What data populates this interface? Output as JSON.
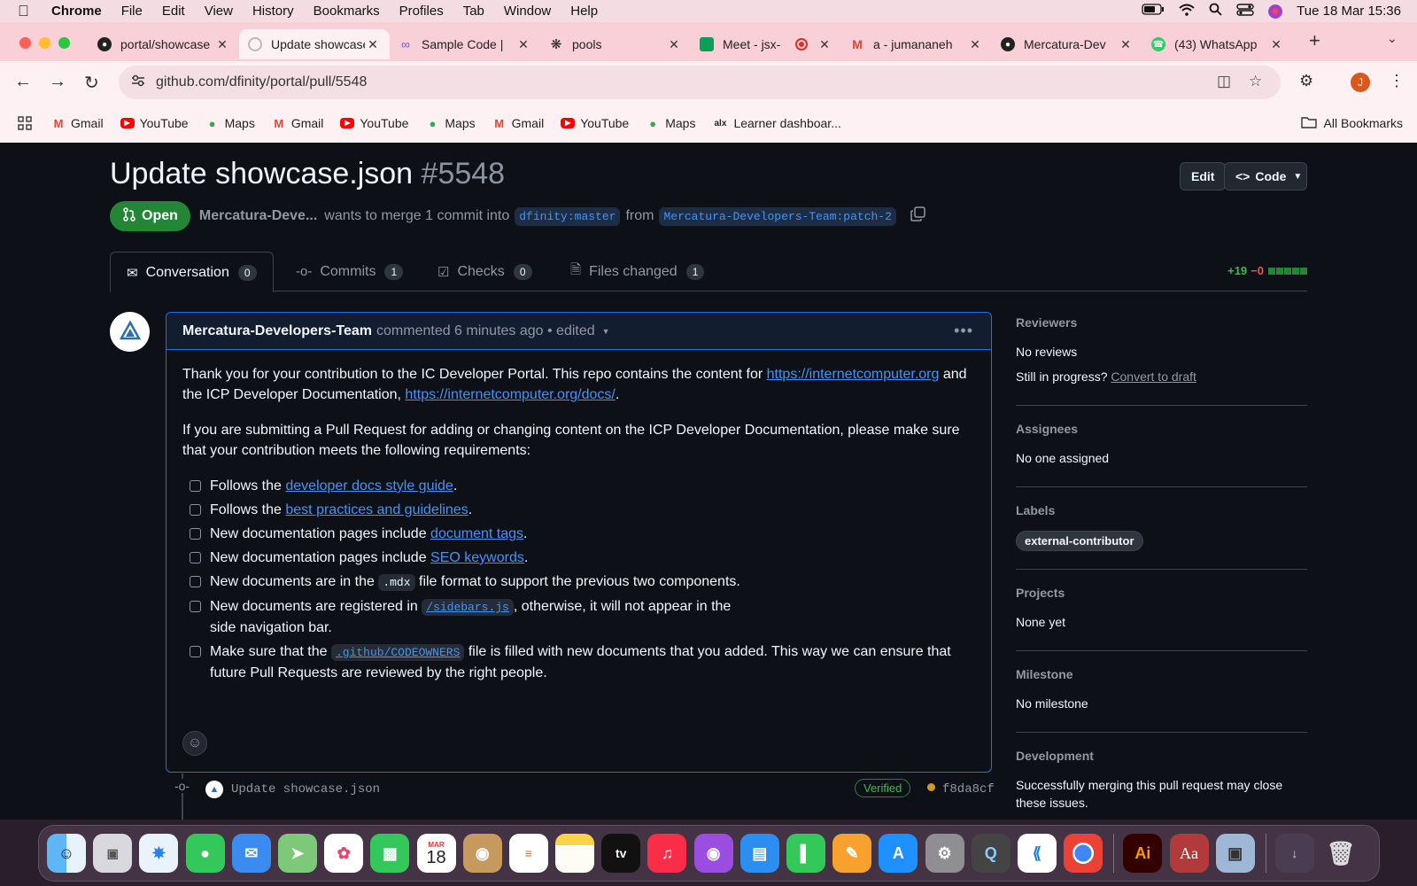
{
  "menubar": {
    "app": "Chrome",
    "items": [
      "File",
      "Edit",
      "View",
      "History",
      "Bookmarks",
      "Profiles",
      "Tab",
      "Window",
      "Help"
    ],
    "clock": "Tue 18 Mar  15:36"
  },
  "tabs": [
    {
      "title": "portal/showcase",
      "icon": "github-icon",
      "active": false
    },
    {
      "title": "Update showcase",
      "icon": "loading-icon",
      "active": true
    },
    {
      "title": "Sample Code |",
      "icon": "link-icon",
      "active": false
    },
    {
      "title": "pools",
      "icon": "openai-icon",
      "active": false
    },
    {
      "title": "Meet - jsx-",
      "icon": "meet-icon",
      "active": false
    },
    {
      "title": "a - jumananeh",
      "icon": "gmail-icon",
      "active": false
    },
    {
      "title": "Mercatura-Dev",
      "icon": "github-icon",
      "active": false
    },
    {
      "title": "(43) WhatsApp",
      "icon": "whatsapp-icon",
      "active": false
    }
  ],
  "address_bar": {
    "url": "github.com/dfinity/portal/pull/5548"
  },
  "profile_initial": "J",
  "bookmarks": [
    {
      "label": "Gmail",
      "icon": "gmail-icon"
    },
    {
      "label": "YouTube",
      "icon": "youtube-icon"
    },
    {
      "label": "Maps",
      "icon": "maps-icon"
    },
    {
      "label": "Gmail",
      "icon": "gmail-icon"
    },
    {
      "label": "YouTube",
      "icon": "youtube-icon"
    },
    {
      "label": "Maps",
      "icon": "maps-icon"
    },
    {
      "label": "Gmail",
      "icon": "gmail-icon"
    },
    {
      "label": "YouTube",
      "icon": "youtube-icon"
    },
    {
      "label": "Maps",
      "icon": "maps-icon"
    },
    {
      "label": "Learner dashboar...",
      "icon": "alx-icon"
    }
  ],
  "all_bookmarks_label": "All Bookmarks",
  "pr": {
    "title": "Update showcase.json",
    "number": "#5548",
    "edit_label": "Edit",
    "code_label": "Code",
    "status": "Open",
    "author": "Mercatura-Deve...",
    "merge_text_1": "wants to merge 1 commit into",
    "base_branch": "dfinity:master",
    "merge_text_2": "from",
    "head_branch": "Mercatura-Developers-Team:patch-2",
    "tabs": [
      {
        "label": "Conversation",
        "count": "0"
      },
      {
        "label": "Commits",
        "count": "1"
      },
      {
        "label": "Checks",
        "count": "0"
      },
      {
        "label": "Files changed",
        "count": "1"
      }
    ],
    "additions": "+19",
    "deletions": "−0"
  },
  "comment": {
    "author": "Mercatura-Developers-Team",
    "meta": "commented 6 minutes ago • edited",
    "p1_text": "Thank you for your contribution to the IC Developer Portal. This repo contains the content for ",
    "p1_link1": "https://internetcomputer.org",
    "p1_mid": " and the ICP Developer Documentation, ",
    "p1_link2": "https://internetcomputer.org/docs/",
    "p1_end": ".",
    "p2": "If you are submitting a Pull Request for adding or changing content on the ICP Developer Documentation, please make sure that your contribution meets the following requirements:",
    "tasks": {
      "t1_pre": "Follows the ",
      "t1_link": "developer docs style guide",
      "t1_post": ".",
      "t2_pre": "Follows the ",
      "t2_link": "best practices and guidelines",
      "t2_post": ".",
      "t3_pre": "New documentation pages include ",
      "t3_link": "document tags",
      "t3_post": ".",
      "t4_pre": "New documentation pages include ",
      "t4_link": "SEO keywords",
      "t4_post": ".",
      "t5_pre": "New documents are in the ",
      "t5_code": ".mdx",
      "t5_post": " file format to support the previous two components.",
      "t6_pre": "New documents are registered in ",
      "t6_code": "/sidebars.js",
      "t6_post": ", otherwise, it will not appear in the side navigation bar.",
      "t7_pre": "Make sure that the ",
      "t7_code": ".github/CODEOWNERS",
      "t7_post": " file is filled with new documents that you added. This way we can ensure that future Pull Requests are reviewed by the right people."
    }
  },
  "commit": {
    "message": "Update showcase.json",
    "verified": "Verified",
    "sha": "f8da8cf"
  },
  "sidebar": {
    "reviewers_h": "Reviewers",
    "reviewers_v": "No reviews",
    "draft_q": "Still in progress?",
    "draft_link": "Convert to draft",
    "assignees_h": "Assignees",
    "assignees_v": "No one assigned",
    "labels_h": "Labels",
    "label": "external-contributor",
    "projects_h": "Projects",
    "projects_v": "None yet",
    "milestone_h": "Milestone",
    "milestone_v": "No milestone",
    "development_h": "Development",
    "development_v": "Successfully merging this pull request may close these issues."
  },
  "dock": {
    "calendar_month": "MAR",
    "calendar_day": "18",
    "apps": [
      "finder-icon",
      "launchpad-icon",
      "safari-icon",
      "messages-icon",
      "mail-icon",
      "maps-icon",
      "photos-icon",
      "facetime-icon",
      "calendar-icon",
      "contacts-icon",
      "reminders-icon",
      "notes-icon",
      "appletv-icon",
      "music-icon",
      "podcasts-icon",
      "keynote-icon",
      "numbers-icon",
      "pages-icon",
      "appstore-icon",
      "settings-icon",
      "quicktime-icon",
      "vscode-icon",
      "chrome-icon",
      "illustrator-icon",
      "dictionary-icon",
      "preview-icon",
      "downloads-icon",
      "trash-icon"
    ]
  }
}
